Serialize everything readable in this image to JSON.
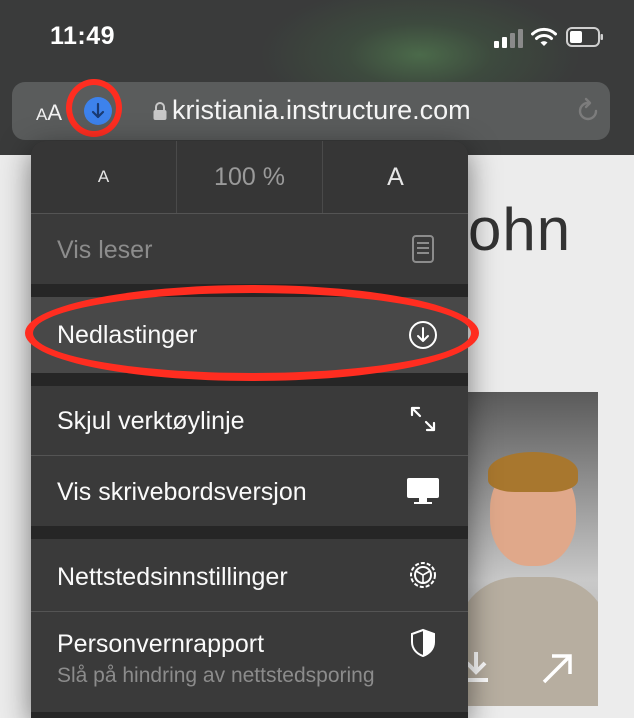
{
  "status_bar": {
    "time": "11:49"
  },
  "url_bar": {
    "text_size_small": "A",
    "text_size_large": "A",
    "url": "kristiania.instructure.com"
  },
  "page": {
    "heading_partial": "ohn"
  },
  "menu": {
    "zoom": {
      "smaller": "A",
      "level": "100 %",
      "larger": "A"
    },
    "reader": {
      "label": "Vis leser"
    },
    "downloads": {
      "label": "Nedlastinger"
    },
    "hide_toolbar": {
      "label": "Skjul verktøylinje"
    },
    "desktop_site": {
      "label": "Vis skrivebordsversjon"
    },
    "website_settings": {
      "label": "Nettstedsinnstillinger"
    },
    "privacy_report": {
      "label": "Personvernrapport",
      "sublabel": "Slå på hindring av nettstedsporing"
    }
  },
  "colors": {
    "annotation_red": "#ff2d20",
    "download_blue": "#3d82ec"
  }
}
